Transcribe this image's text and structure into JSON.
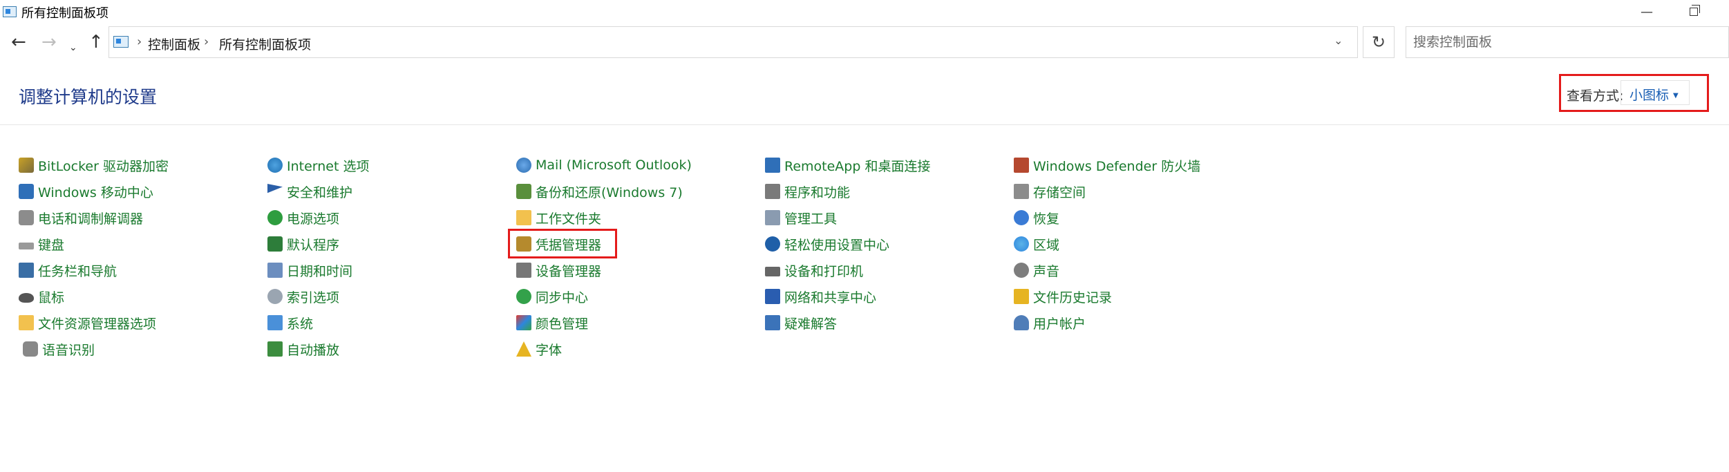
{
  "window": {
    "title": "所有控制面板项",
    "minimize_glyph": "—"
  },
  "nav": {
    "back": "←",
    "forward": "→",
    "recent": "⌄",
    "up": "↑"
  },
  "address": {
    "sep": "›",
    "crumbs": [
      "控制面板",
      "所有控制面板项"
    ],
    "dropdown": "⌄",
    "refresh": "↻"
  },
  "search": {
    "placeholder": "搜索控制面板",
    "value": ""
  },
  "header": {
    "title": "调整计算机的设置",
    "view_label": "查看方式:",
    "view_value": "小图标",
    "view_caret": "▼"
  },
  "colors": {
    "link": "#1a7a2e",
    "title": "#1e3a8a",
    "highlight": "#e41b1b"
  },
  "columns": [
    [
      {
        "label": "BitLocker 驱动器加密",
        "icon": "bitlocker-key-icon"
      },
      {
        "label": "Windows 移动中心",
        "icon": "mobility-center-icon"
      },
      {
        "label": "电话和调制解调器",
        "icon": "phone-modem-icon"
      },
      {
        "label": "键盘",
        "icon": "keyboard-icon"
      },
      {
        "label": "任务栏和导航",
        "icon": "taskbar-icon"
      },
      {
        "label": "鼠标",
        "icon": "mouse-icon"
      },
      {
        "label": "文件资源管理器选项",
        "icon": "folder-options-icon"
      },
      {
        "label": "语音识别",
        "icon": "microphone-icon"
      }
    ],
    [
      {
        "label": "Internet 选项",
        "icon": "internet-globe-icon"
      },
      {
        "label": "安全和维护",
        "icon": "security-flag-icon"
      },
      {
        "label": "电源选项",
        "icon": "power-options-icon"
      },
      {
        "label": "默认程序",
        "icon": "default-programs-icon"
      },
      {
        "label": "日期和时间",
        "icon": "date-time-icon"
      },
      {
        "label": "索引选项",
        "icon": "indexing-icon"
      },
      {
        "label": "系统",
        "icon": "system-computer-icon"
      },
      {
        "label": "自动播放",
        "icon": "autoplay-icon"
      }
    ],
    [
      {
        "label": "Mail (Microsoft Outlook)",
        "icon": "mail-icon"
      },
      {
        "label": "备份和还原(Windows 7)",
        "icon": "backup-restore-icon"
      },
      {
        "label": "工作文件夹",
        "icon": "work-folders-icon"
      },
      {
        "label": "凭据管理器",
        "icon": "credential-manager-icon"
      },
      {
        "label": "设备管理器",
        "icon": "device-manager-icon"
      },
      {
        "label": "同步中心",
        "icon": "sync-center-icon"
      },
      {
        "label": "颜色管理",
        "icon": "color-management-icon"
      },
      {
        "label": "字体",
        "icon": "fonts-icon"
      }
    ],
    [
      {
        "label": "RemoteApp 和桌面连接",
        "icon": "remoteapp-icon"
      },
      {
        "label": "程序和功能",
        "icon": "programs-features-icon"
      },
      {
        "label": "管理工具",
        "icon": "admin-tools-icon"
      },
      {
        "label": "轻松使用设置中心",
        "icon": "ease-of-access-icon"
      },
      {
        "label": "设备和打印机",
        "icon": "printer-icon"
      },
      {
        "label": "网络和共享中心",
        "icon": "network-icon"
      },
      {
        "label": "疑难解答",
        "icon": "troubleshoot-icon"
      }
    ],
    [
      {
        "label": "Windows Defender 防火墙",
        "icon": "firewall-icon"
      },
      {
        "label": "存储空间",
        "icon": "storage-spaces-icon"
      },
      {
        "label": "恢复",
        "icon": "recovery-icon"
      },
      {
        "label": "区域",
        "icon": "region-icon"
      },
      {
        "label": "声音",
        "icon": "sound-icon"
      },
      {
        "label": "文件历史记录",
        "icon": "file-history-icon"
      },
      {
        "label": "用户帐户",
        "icon": "user-accounts-icon"
      }
    ]
  ]
}
